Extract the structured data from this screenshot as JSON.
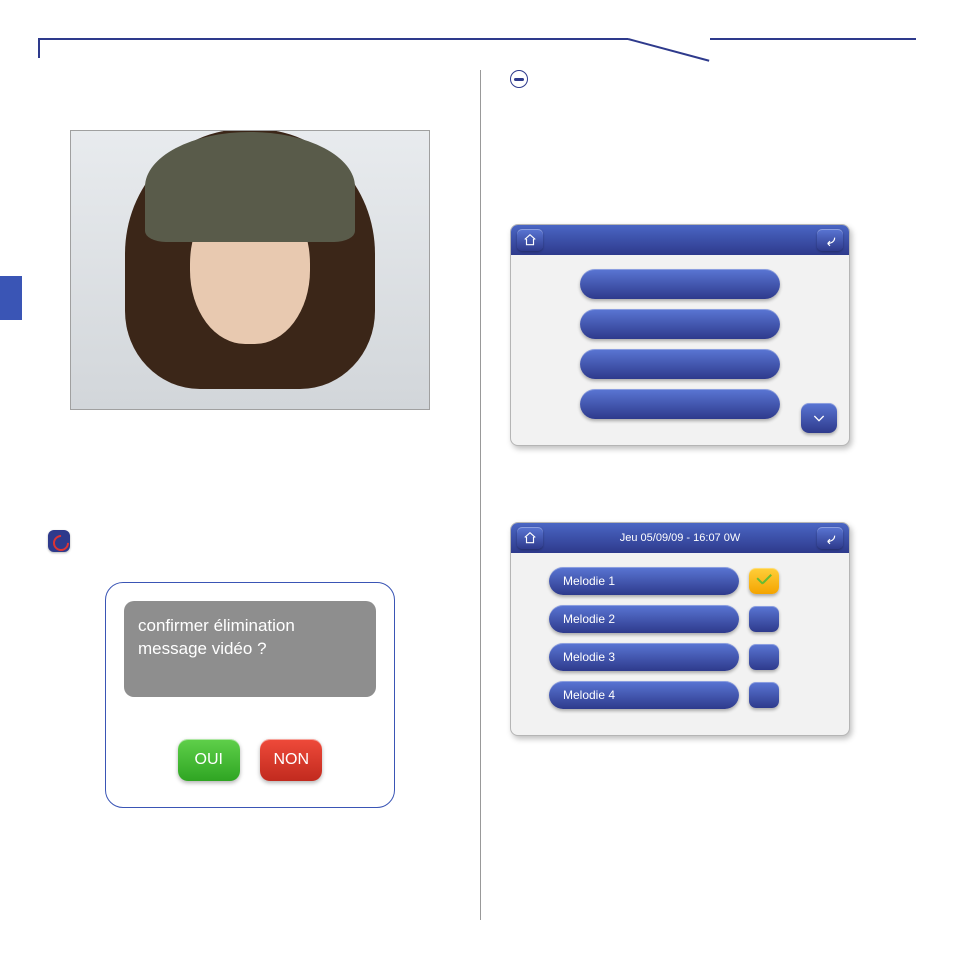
{
  "left": {
    "dialog": {
      "message_line1": "confirmer élimination",
      "message_line2": "message vidéo ?",
      "yes": "OUI",
      "no": "NON"
    }
  },
  "right": {
    "screen1": {
      "titlebar_text": "",
      "rows": [
        "",
        "",
        "",
        ""
      ]
    },
    "screen2": {
      "titlebar_text": "Jeu 05/09/09 - 16:07   0W",
      "melodies": [
        {
          "label": "Melodie 1",
          "selected": true
        },
        {
          "label": "Melodie 2",
          "selected": false
        },
        {
          "label": "Melodie 3",
          "selected": false
        },
        {
          "label": "Melodie 4",
          "selected": false
        }
      ]
    }
  }
}
